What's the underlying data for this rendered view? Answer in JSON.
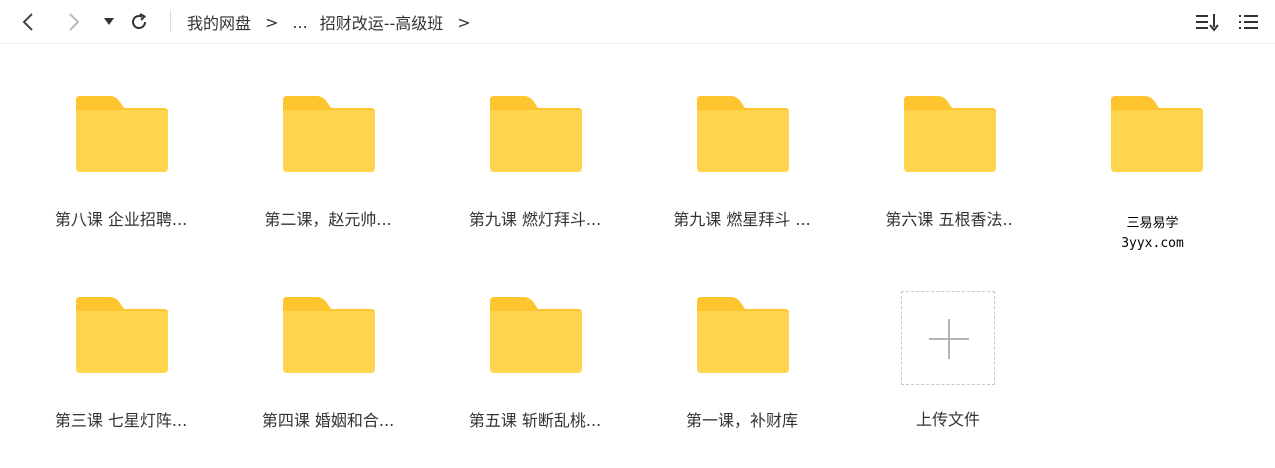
{
  "toolbar": {
    "breadcrumb": [
      "我的网盘",
      "...",
      "招财改运--高级班"
    ],
    "separator": ">",
    "icons": [
      "back-icon",
      "forward-icon",
      "dropdown-icon",
      "refresh-icon",
      "sort-icon",
      "list-view-icon"
    ]
  },
  "folders": [
    {
      "label": "第八课  企业招聘..."
    },
    {
      "label": "第二课，赵元帅..."
    },
    {
      "label": "第九课  燃灯拜斗..."
    },
    {
      "label": "第九课 燃星拜斗 ..."
    },
    {
      "label": "第六课  五根香法.."
    },
    {
      "label": ""
    },
    {
      "label": "第三课 七星灯阵..."
    },
    {
      "label": "第四课  婚姻和合..."
    },
    {
      "label": "第五课  斩断乱桃..."
    },
    {
      "label": "第一课，补财库"
    }
  ],
  "upload": {
    "label": "上传文件"
  },
  "watermark": {
    "line1": "三易易学",
    "line2": "3yyx.com"
  },
  "colors": {
    "folder_body": "#FFD54F",
    "folder_tab": "#FFC52E",
    "accent": "#333333"
  }
}
